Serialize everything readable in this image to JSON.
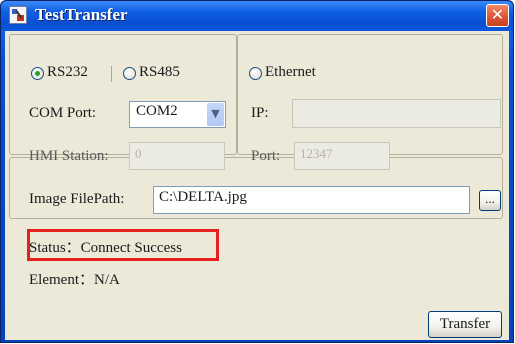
{
  "window": {
    "title": "TestTransfer",
    "close_glyph": "✕"
  },
  "connection": {
    "rs232_label": "RS232",
    "rs485_label": "RS485",
    "ethernet_label": "Ethernet",
    "selected": "RS232",
    "com_port_label": "COM Port:",
    "com_port_value": "COM2",
    "hmi_station_label": "HMI Station:",
    "hmi_station_value": "0",
    "ip_label": "IP:",
    "ip_value": "",
    "port_label": "Port:",
    "port_value": "12347"
  },
  "image": {
    "filepath_label": "Image FilePath:",
    "filepath_value": "C:\\DELTA.jpg",
    "browse_label": "..."
  },
  "status": {
    "status_text": "Status：Connect Success",
    "element_text": "Element：N/A"
  },
  "actions": {
    "transfer_label": "Transfer"
  },
  "colors": {
    "highlight": "#e5201f",
    "titlebar": "#0a4fd0"
  },
  "icons": {
    "app": "transfer-app-icon",
    "close": "close-icon",
    "dropdown": "chevron-down-icon"
  }
}
